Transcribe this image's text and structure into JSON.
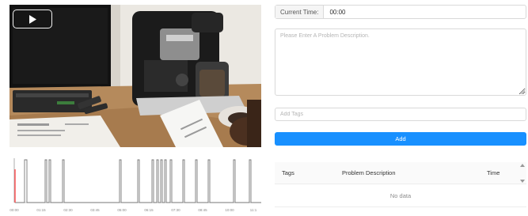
{
  "player": {
    "play_icon": "play-icon"
  },
  "timeline": {
    "tick_labels": [
      "00:00",
      "01:15",
      "02:30",
      "03:45",
      "05:00",
      "06:15",
      "07:30",
      "08:45",
      "10:00",
      "11:1"
    ],
    "playhead_color": "#ff4d4f",
    "trace_color": "#777777"
  },
  "form": {
    "current_time_label": "Current Time:",
    "current_time_value": "00:00",
    "description_placeholder": "Please Enter A Problem Description.",
    "tags_placeholder": "Add Tags",
    "add_label": "Add"
  },
  "table": {
    "columns": [
      "Tags",
      "Problem Description",
      "Time"
    ],
    "empty_text": "No data"
  },
  "colors": {
    "accent": "#1890ff"
  }
}
